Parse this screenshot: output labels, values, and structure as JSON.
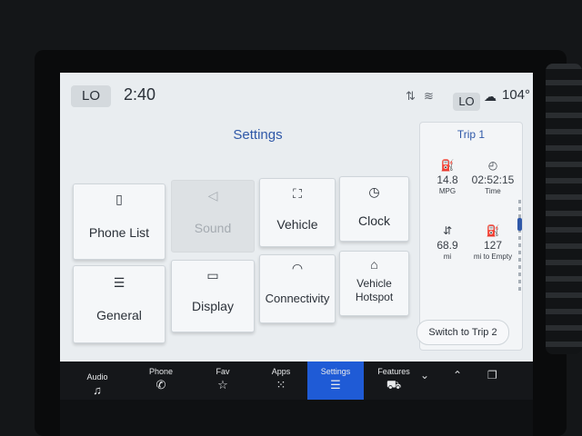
{
  "status": {
    "lo_left": "LO",
    "time": "2:40",
    "lo_right": "LO",
    "temperature": "104°"
  },
  "settings": {
    "title": "Settings",
    "tiles": [
      {
        "label": "Phone List",
        "icon": "phone-list-icon",
        "glyph": "▯"
      },
      {
        "label": "Sound",
        "icon": "speaker-icon",
        "glyph": "◁",
        "disabled": true
      },
      {
        "label": "Vehicle",
        "icon": "vehicle-icon",
        "glyph": "⛶"
      },
      {
        "label": "Clock",
        "icon": "clock-icon",
        "glyph": "◷"
      },
      {
        "label": "General",
        "icon": "sliders-icon",
        "glyph": "☰"
      },
      {
        "label": "Display",
        "icon": "display-icon",
        "glyph": "▭"
      },
      {
        "label": "Connectivity",
        "icon": "wifi-icon",
        "glyph": "◠"
      },
      {
        "label": "Vehicle Hotspot",
        "icon": "hotspot-icon",
        "glyph": "⌂"
      }
    ]
  },
  "trip": {
    "title": "Trip 1",
    "stats": [
      {
        "value": "14.8",
        "unit": "MPG",
        "icon": "fuel-icon"
      },
      {
        "value": "02:52:15",
        "unit": "Time",
        "icon": "timer-icon"
      },
      {
        "value": "68.9",
        "unit": "mi",
        "icon": "distance-icon"
      },
      {
        "value": "127",
        "unit": "mi to Empty",
        "icon": "range-icon"
      }
    ],
    "switch_label": "Switch to Trip 2"
  },
  "dock": {
    "items": [
      {
        "label": "Audio",
        "icon": "music-icon"
      },
      {
        "label": "Phone",
        "icon": "phone-icon"
      },
      {
        "label": "Fav",
        "icon": "star-icon"
      },
      {
        "label": "Apps",
        "icon": "apps-grid-icon"
      },
      {
        "label": "Settings",
        "icon": "settings-sliders-icon",
        "active": true
      },
      {
        "label": "Features",
        "icon": "car-features-icon"
      }
    ]
  },
  "colors": {
    "accent": "#2f58a8",
    "active_tab": "#1f5bd6",
    "screen_bg": "#e9edf0"
  }
}
